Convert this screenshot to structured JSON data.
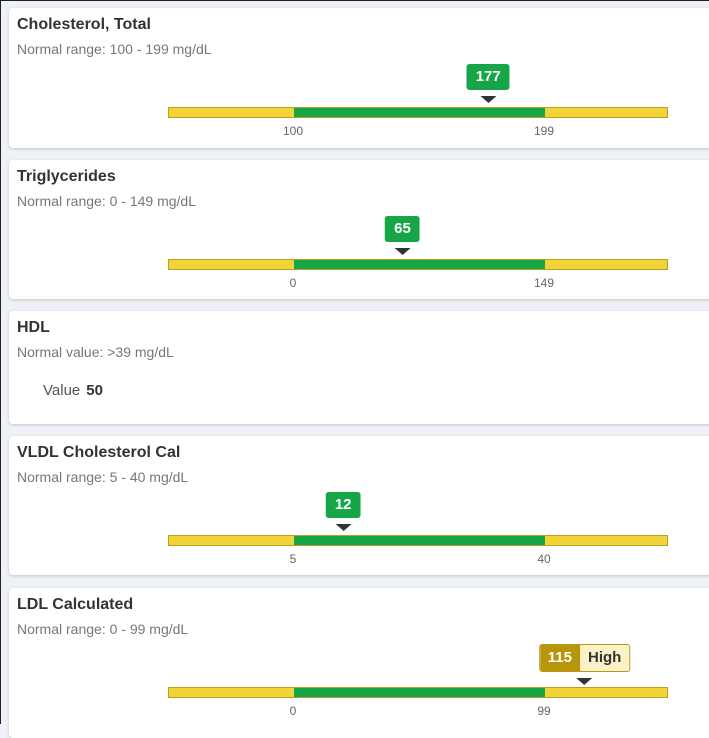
{
  "tests": [
    {
      "name": "Cholesterol, Total",
      "range_text": "Normal range: 100 - 199 mg/dL",
      "low": 100,
      "high": 199,
      "value": 177,
      "status": ""
    },
    {
      "name": "Triglycerides",
      "range_text": "Normal range: 0 - 149 mg/dL",
      "low": 0,
      "high": 149,
      "value": 65,
      "status": ""
    },
    {
      "name": "HDL",
      "range_text": "Normal value: >39 mg/dL",
      "value_label": "Value",
      "value": 50
    },
    {
      "name": "VLDL Cholesterol Cal",
      "range_text": "Normal range: 5 - 40 mg/dL",
      "low": 5,
      "high": 40,
      "value": 12,
      "status": ""
    },
    {
      "name": "LDL Calculated",
      "range_text": "Normal range: 0 - 99 mg/dL",
      "low": 0,
      "high": 99,
      "value": 115,
      "status": "High"
    }
  ],
  "colors": {
    "normal": "#17a647",
    "out_of_range": "#f2d338",
    "high_badge": "#b8960c"
  }
}
